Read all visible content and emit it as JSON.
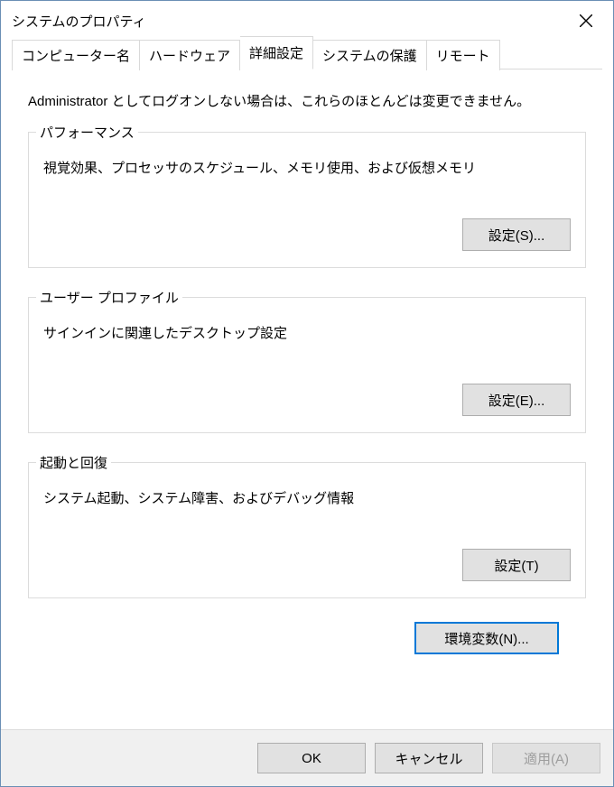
{
  "window": {
    "title": "システムのプロパティ"
  },
  "tabs": {
    "computer_name": "コンピューター名",
    "hardware": "ハードウェア",
    "advanced": "詳細設定",
    "system_protection": "システムの保護",
    "remote": "リモート"
  },
  "intro": "Administrator としてログオンしない場合は、これらのほとんどは変更できません。",
  "groups": {
    "performance": {
      "legend": "パフォーマンス",
      "desc": "視覚効果、プロセッサのスケジュール、メモリ使用、および仮想メモリ",
      "button": "設定(S)..."
    },
    "user_profiles": {
      "legend": "ユーザー プロファイル",
      "desc": "サインインに関連したデスクトップ設定",
      "button": "設定(E)..."
    },
    "startup_recovery": {
      "legend": "起動と回復",
      "desc": "システム起動、システム障害、およびデバッグ情報",
      "button": "設定(T)"
    }
  },
  "env_button": "環境変数(N)...",
  "footer": {
    "ok": "OK",
    "cancel": "キャンセル",
    "apply": "適用(A)"
  }
}
